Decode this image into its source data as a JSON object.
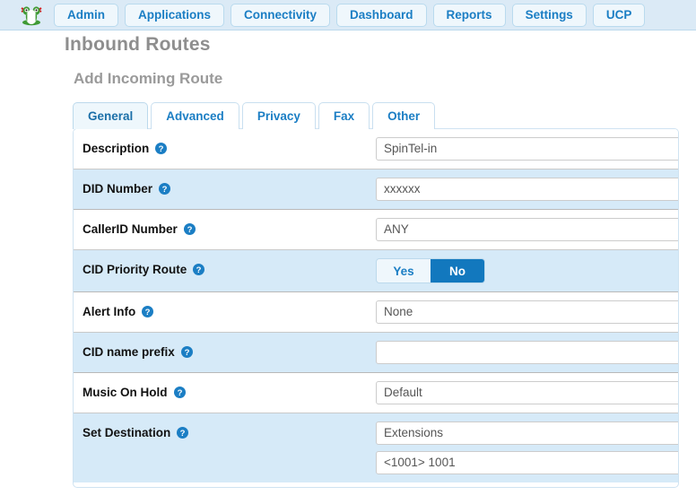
{
  "nav": {
    "logo_icon": "freepbx-frog-logo",
    "items": [
      {
        "label": "Admin"
      },
      {
        "label": "Applications"
      },
      {
        "label": "Connectivity"
      },
      {
        "label": "Dashboard"
      },
      {
        "label": "Reports"
      },
      {
        "label": "Settings"
      },
      {
        "label": "UCP"
      }
    ]
  },
  "header": {
    "title": "Inbound Routes",
    "subtitle": "Add Incoming Route"
  },
  "tabs": [
    {
      "label": "General",
      "active": true
    },
    {
      "label": "Advanced",
      "active": false
    },
    {
      "label": "Privacy",
      "active": false
    },
    {
      "label": "Fax",
      "active": false
    },
    {
      "label": "Other",
      "active": false
    }
  ],
  "form": {
    "description": {
      "label": "Description",
      "value": "SpinTel-in"
    },
    "did_number": {
      "label": "DID Number",
      "value": "xxxxxx"
    },
    "callerid": {
      "label": "CallerID Number",
      "value": "ANY"
    },
    "cid_priority": {
      "label": "CID Priority Route",
      "options": [
        "Yes",
        "No"
      ],
      "selected": "No"
    },
    "alert_info": {
      "label": "Alert Info",
      "value": "None"
    },
    "cid_prefix": {
      "label": "CID name prefix",
      "value": ""
    },
    "music_on_hold": {
      "label": "Music On Hold",
      "value": "Default"
    },
    "set_destination": {
      "label": "Set Destination",
      "value_primary": "Extensions",
      "value_secondary": "<1001> 1001"
    }
  },
  "icons": {
    "help": "help-circle-icon"
  },
  "colors": {
    "nav_background": "#dbeaf6",
    "accent_blue": "#1b7ec4",
    "toggle_selected": "#1278be",
    "row_alt_background": "#d6eaf8",
    "heading_gray": "#8e8e8e"
  }
}
